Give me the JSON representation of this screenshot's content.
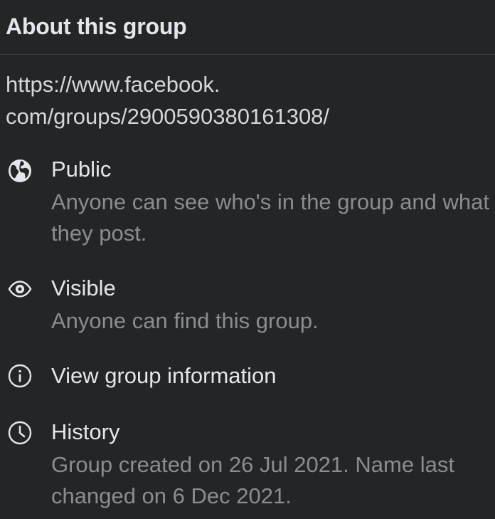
{
  "header": {
    "title": "About this group"
  },
  "group_url": {
    "line1": "https://www.facebook.",
    "line2": "com/groups/2900590380161308/"
  },
  "items": [
    {
      "icon": "globe-icon",
      "title": "Public",
      "description": "Anyone can see who's in the group and what they post."
    },
    {
      "icon": "eye-icon",
      "title": "Visible",
      "description": "Anyone can find this group."
    },
    {
      "icon": "info-icon",
      "title": "View group information",
      "description": ""
    },
    {
      "icon": "clock-icon",
      "title": "History",
      "description": "Group created on 26 Jul 2021. Name last changed on 6 Dec 2021."
    }
  ],
  "colors": {
    "background": "#242526",
    "primary_text": "#e4e6eb",
    "secondary_text": "#8a8d91",
    "divider": "#3a3b3c"
  }
}
